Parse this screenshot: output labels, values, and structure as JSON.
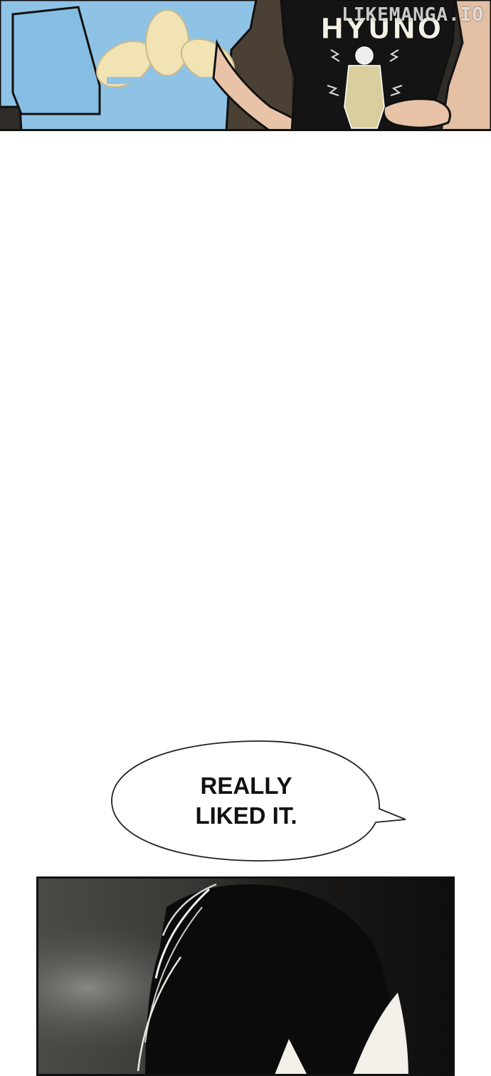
{
  "watermark": "LIKEMANGA.IO",
  "shirt_text": "HYUNO",
  "speech_bubble": {
    "lines": [
      "REALLY",
      "LIKED IT."
    ]
  },
  "colors": {
    "panel_dark": "#2a2622",
    "shirt_blue": "#8fc3e6",
    "logo_cream": "#f1e3b3",
    "skin": "#e8c3a8",
    "black_shirt": "#141414",
    "bubble_fill": "#ffffff",
    "ink": "#111111"
  }
}
